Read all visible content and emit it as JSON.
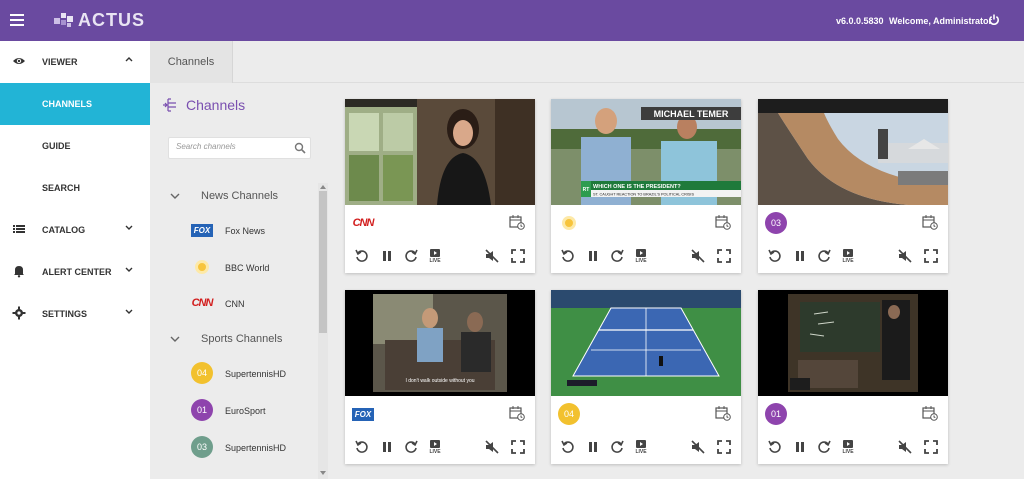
{
  "header": {
    "logo_text": "ACTUS",
    "version": "v6.0.0.5830",
    "welcome": "Welcome, Administrator",
    "accent_color": "#6a4aa0"
  },
  "sidebar": {
    "items": [
      {
        "label": "VIEWER",
        "icon": "eye-icon"
      },
      {
        "label": "CHANNELS",
        "active": true
      },
      {
        "label": "GUIDE"
      },
      {
        "label": "SEARCH"
      },
      {
        "label": "CATALOG",
        "icon": "list-icon"
      },
      {
        "label": "ALERT CENTER",
        "icon": "bell-icon"
      },
      {
        "label": "SETTINGS",
        "icon": "gear-icon"
      }
    ],
    "active_color": "#22b4d6"
  },
  "tabs": [
    {
      "label": "Channels"
    }
  ],
  "panel": {
    "title": "Channels",
    "search_placeholder": "Search channels",
    "groups": [
      {
        "label": "News Channels",
        "channels": [
          {
            "name": "Fox News",
            "logo": "FOX"
          },
          {
            "name": "BBC World",
            "logo": "bbc-icon"
          },
          {
            "name": "CNN",
            "logo": "CNN"
          }
        ]
      },
      {
        "label": "Sports Channels",
        "channels": [
          {
            "name": "SupertennisHD",
            "badge": "04",
            "color": "#f2c12e"
          },
          {
            "name": "EuroSport",
            "badge": "01",
            "color": "#8e44ad"
          },
          {
            "name": "SupertennisHD",
            "badge": "03",
            "color": "#6f9e8c"
          }
        ]
      }
    ]
  },
  "grid": {
    "cards": [
      {
        "logo": "CNN",
        "scene": "interview-woman"
      },
      {
        "logo": "bbc-icon",
        "scene": "news-street",
        "caption_name": "MICHAEL TEMER",
        "caption_line1": "WHICH ONE IS THE PRESIDENT?",
        "caption_line2": "ST. CAUGHT REACTION TO BRAZIL'S POLITICAL CRISIS",
        "corner_tag": "RT"
      },
      {
        "logo": "badge",
        "badge": "03",
        "badge_color": "#8e44ad",
        "scene": "skate-ramp"
      },
      {
        "logo": "FOX",
        "scene": "sofa-scene",
        "subtitle": "I don't walk outside without you"
      },
      {
        "logo": "badge",
        "badge": "04",
        "badge_color": "#f2c12e",
        "scene": "tennis-court"
      },
      {
        "logo": "badge",
        "badge": "01",
        "badge_color": "#8e44ad",
        "scene": "classroom"
      }
    ],
    "controls": {
      "live_label": "LIVE"
    }
  }
}
